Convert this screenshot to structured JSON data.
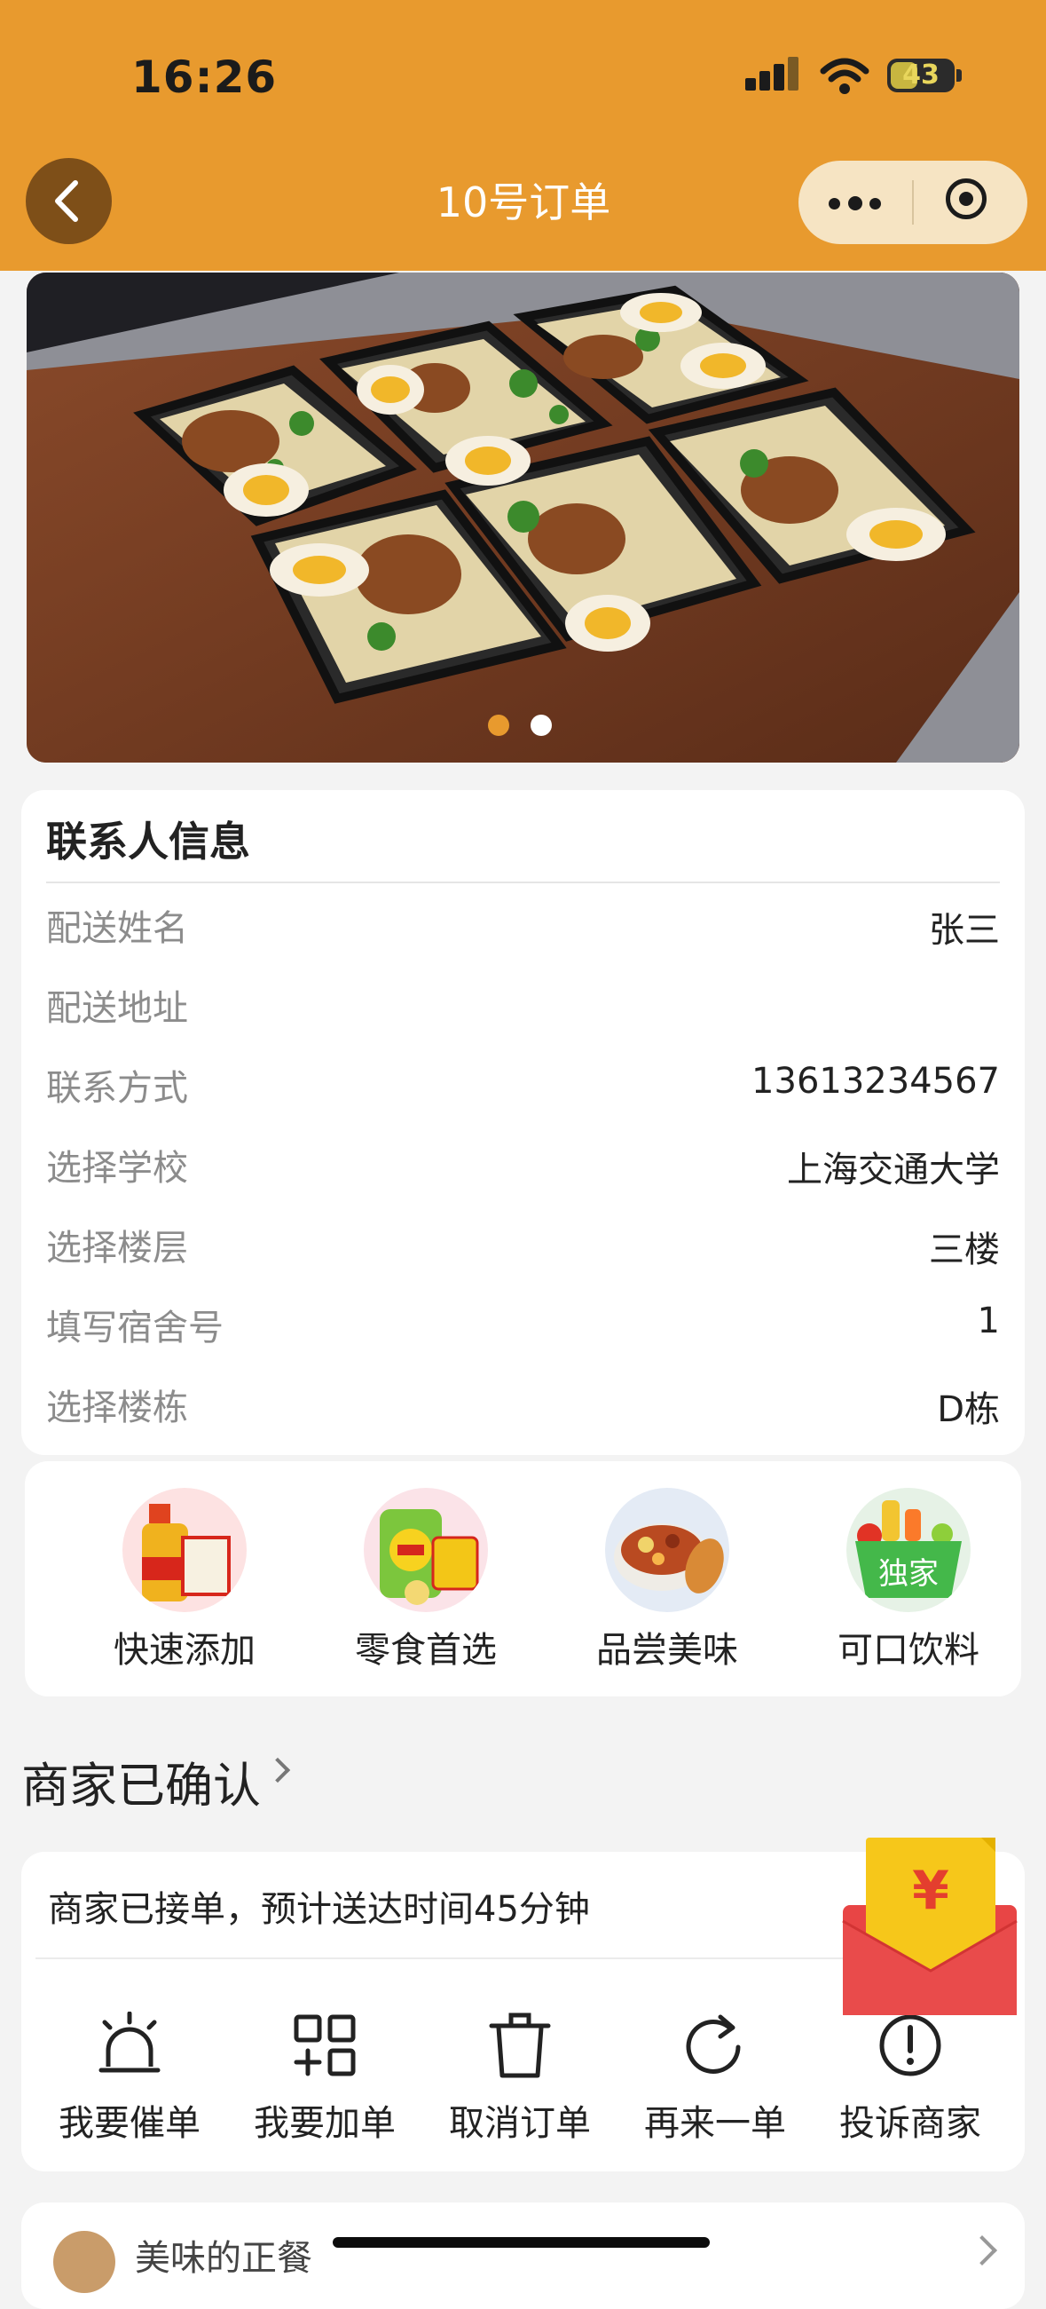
{
  "status_bar": {
    "time": "16:26",
    "battery": "43"
  },
  "nav": {
    "title": "10号订单",
    "back_icon": "chevron-left-icon",
    "more_icon": "more-dots-icon",
    "close_icon": "target-icon"
  },
  "banner": {
    "pages": 2,
    "active_page": 1,
    "active_color": "#e89a2e",
    "inactive_color": "#ffffff"
  },
  "contact": {
    "title": "联系人信息",
    "rows": [
      {
        "label": "配送姓名",
        "value": "张三"
      },
      {
        "label": "配送地址",
        "value": ""
      },
      {
        "label": "联系方式",
        "value": "13613234567"
      },
      {
        "label": "选择学校",
        "value": "上海交通大学"
      },
      {
        "label": "选择楼层",
        "value": "三楼"
      },
      {
        "label": "填写宿舍号",
        "value": "1"
      },
      {
        "label": "选择楼栋",
        "value": "D栋"
      }
    ]
  },
  "categories": [
    {
      "label": "快速添加",
      "icon": "grocery-icon"
    },
    {
      "label": "零食首选",
      "icon": "snack-icon"
    },
    {
      "label": "品尝美味",
      "icon": "food-bowl-icon"
    },
    {
      "label": "可口饮料",
      "icon": "drink-basket-icon"
    }
  ],
  "category_badge": "独家",
  "order_status": {
    "title": "商家已确认",
    "message": "商家已接单，预计送达时间45分钟",
    "actions": [
      {
        "label": "我要催单",
        "icon": "alarm-icon"
      },
      {
        "label": "我要加单",
        "icon": "add-grid-icon"
      },
      {
        "label": "取消订单",
        "icon": "trash-icon"
      },
      {
        "label": "再来一单",
        "icon": "refresh-icon"
      },
      {
        "label": "投诉商家",
        "icon": "warning-circle-icon"
      }
    ]
  },
  "red_envelope": {
    "symbol": "¥"
  },
  "bottom_peek": {
    "text": "美味的正餐"
  },
  "colors": {
    "header": "#e89a2e",
    "back_button": "#7e4f18",
    "capsule": "#f6e4c3"
  }
}
